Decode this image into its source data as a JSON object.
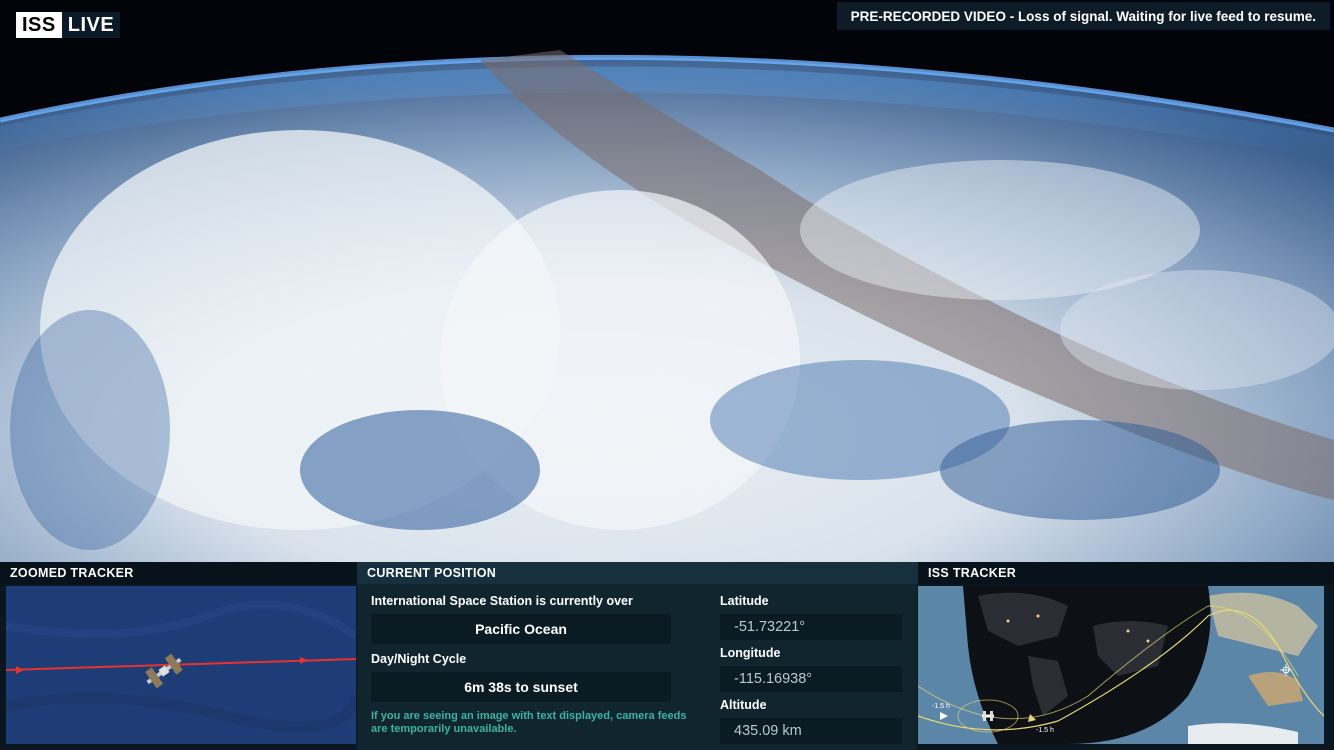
{
  "logo": {
    "iss": "ISS",
    "live": "LIVE"
  },
  "status_banner": "PRE-RECORDED VIDEO - Loss of signal. Waiting for live feed to resume.",
  "panels": {
    "zoomed_tracker": "ZOOMED TRACKER",
    "current_position": "CURRENT POSITION",
    "iss_tracker": "ISS TRACKER"
  },
  "position": {
    "over_label": "International Space Station is currently over",
    "over_value": "Pacific Ocean",
    "cycle_label": "Day/Night Cycle",
    "cycle_value": "6m 38s to sunset",
    "note": "If you are seeing an image with text displayed, camera feeds are temporarily unavailable.",
    "latitude_label": "Latitude",
    "latitude_value": "-51.73221°",
    "longitude_label": "Longitude",
    "longitude_value": "-115.16938°",
    "altitude_label": "Altitude",
    "altitude_value": "435.09 km"
  },
  "map_markers": {
    "left": "-1.5 h",
    "right": "-1.5 h"
  },
  "colors": {
    "track_red": "#e8322f",
    "teal_note": "#3bb3a3",
    "orbit_yellow": "#e8d77a"
  }
}
